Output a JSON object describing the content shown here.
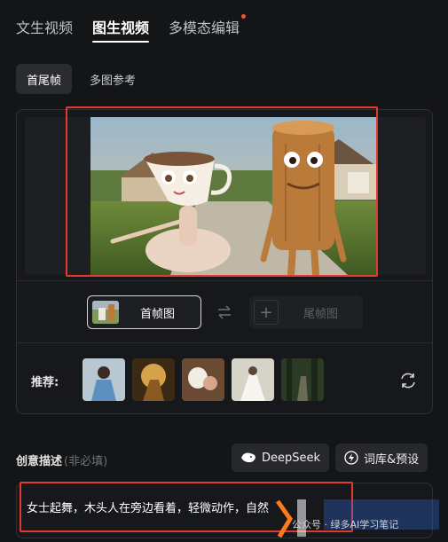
{
  "tabs": [
    {
      "label": "文生视频",
      "active": false
    },
    {
      "label": "图生视频",
      "active": true
    },
    {
      "label": "多模态编辑",
      "active": false,
      "has_badge": true
    }
  ],
  "subtabs": [
    {
      "label": "首尾帧",
      "active": true
    },
    {
      "label": "多图参考",
      "active": false
    }
  ],
  "frames": {
    "first_label": "首帧图",
    "last_label": "尾帧图",
    "swap_icon": "swap-icon",
    "add_icon": "plus-icon"
  },
  "recommend": {
    "label": "推荐:",
    "thumbnails": [
      "girl-in-blue-dress",
      "golden-warrior",
      "lamb-with-child",
      "bride-in-white",
      "forest-archer"
    ],
    "refresh_icon": "refresh-icon"
  },
  "description": {
    "label": "创意描述",
    "optional": "(非必填)",
    "text": "女士起舞，木头人在旁边看着，轻微动作，自然"
  },
  "buttons": {
    "deepseek": "DeepSeek",
    "library": "词库&预设"
  },
  "watermark": {
    "text": "公众号 · 绿多AI学习笔记"
  },
  "colors": {
    "accent_red": "#e23a2e",
    "badge_dot": "#ff4d3d",
    "background": "#141517"
  }
}
